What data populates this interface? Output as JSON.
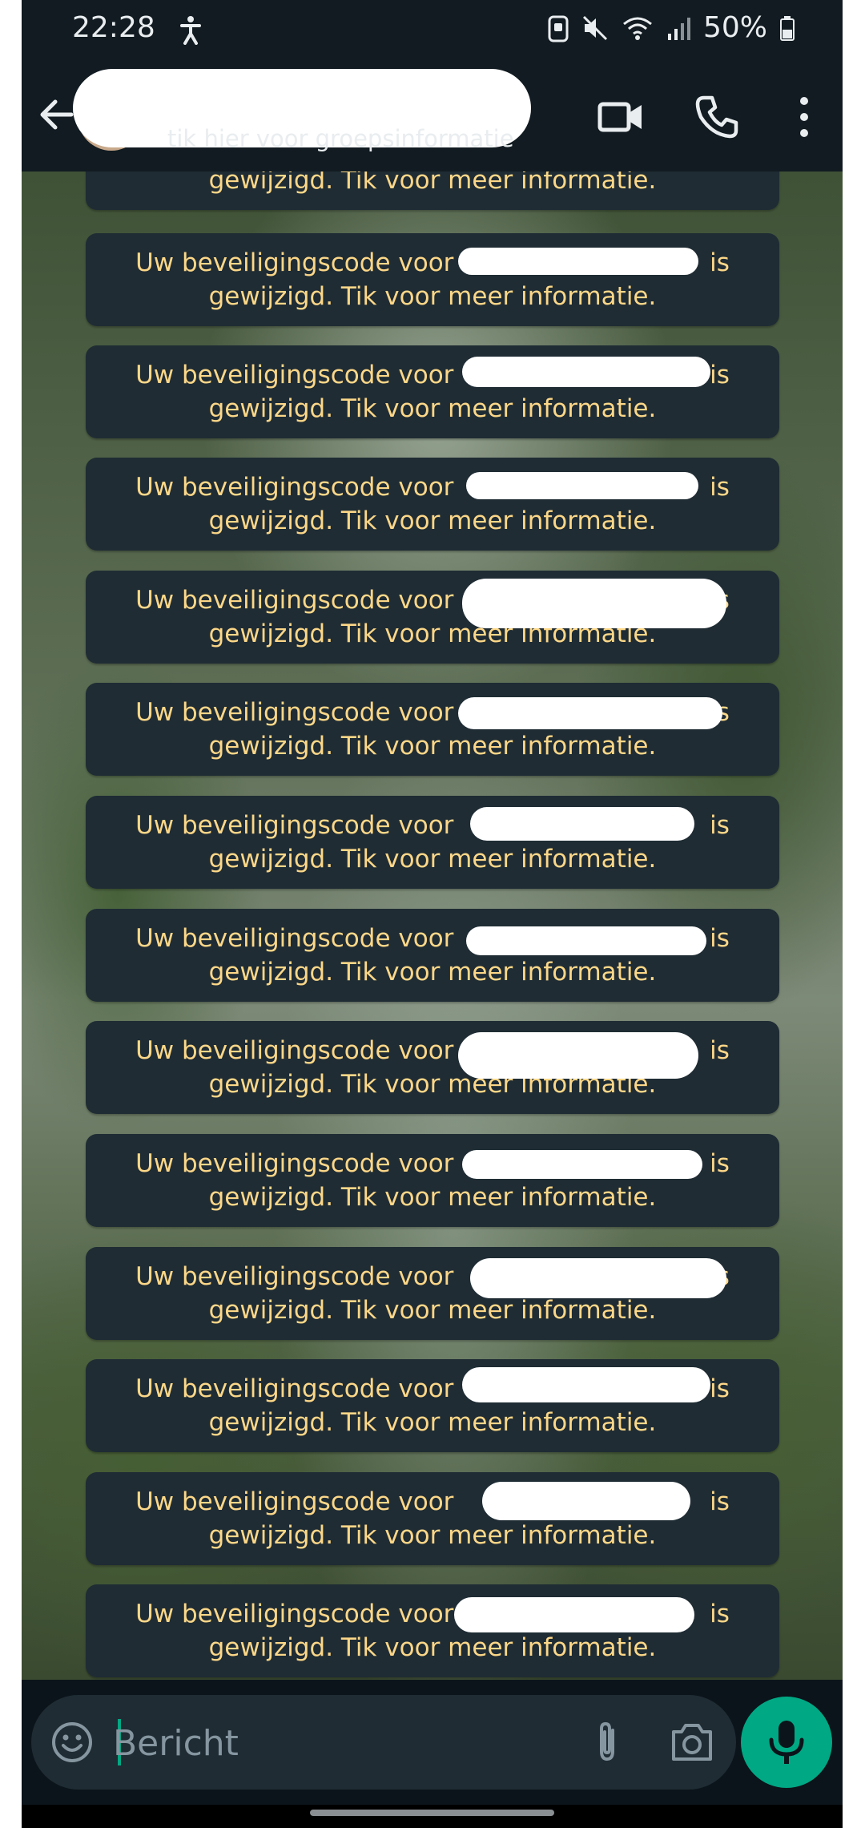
{
  "status_bar": {
    "time": "22:28",
    "battery": "50%",
    "icons": [
      "accessibility-icon",
      "screenshot-icon",
      "mute-icon",
      "wifi-icon",
      "signal-icon",
      "battery-icon"
    ]
  },
  "header": {
    "subtitle": "tik hier voor groepsinformatie",
    "icons": [
      "back-arrow-icon",
      "video-call-icon",
      "phone-call-icon",
      "more-vert-icon"
    ]
  },
  "messages": {
    "top_partial_line": "gewijzigd. Tik voor meer informatie.",
    "line1": "Uw beveiligingscode voor",
    "line1_suffix": "is",
    "line2": "gewijzigd. Tik voor meer informatie.",
    "count_full": 13
  },
  "composer": {
    "placeholder": "Bericht",
    "icons": [
      "emoji-icon",
      "attach-icon",
      "camera-icon",
      "mic-icon"
    ]
  },
  "colors": {
    "accent": "#00a884",
    "system_text": "#fcd788",
    "bubble": "#1f2c34",
    "bar": "#111b21"
  }
}
